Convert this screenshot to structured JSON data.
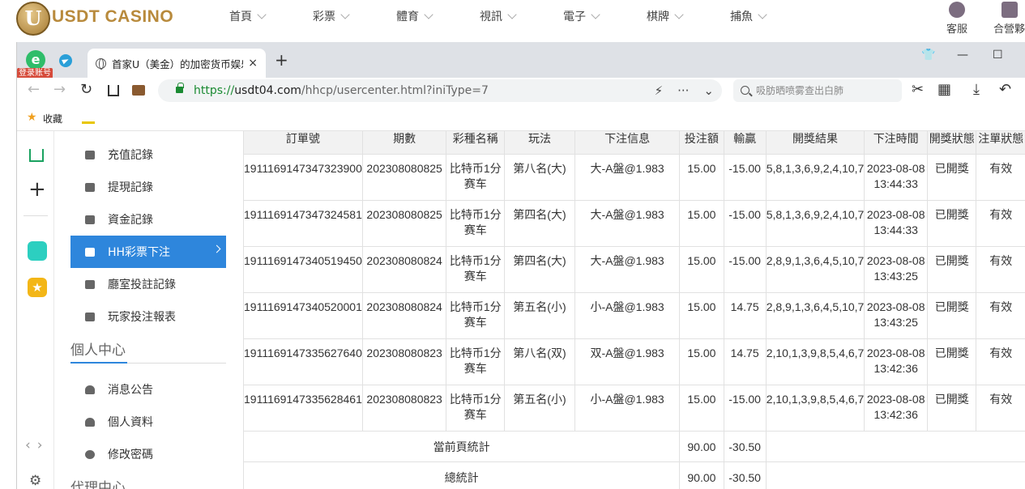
{
  "site": {
    "logo_letter": "U",
    "logo_text": "USDT CASINO",
    "nav": [
      "首頁",
      "彩票",
      "體育",
      "視訊",
      "電子",
      "棋牌",
      "捕魚"
    ],
    "right_items": [
      "客服",
      "合營夥"
    ]
  },
  "browser": {
    "login_badge": "登录账号",
    "ext_letter": "e",
    "tab_title": "首家U（美金）的加密货币娱乐",
    "tab_close": "×",
    "new_tab": "+",
    "url_proto": "https://",
    "url_host": "usdt04.com",
    "url_path": "/hhcp/usercenter.html?iniType=7",
    "search_placeholder": "吸肪晒喷雾查出白肺",
    "bookmark_label": "收藏"
  },
  "sidebar": {
    "items": [
      {
        "label": "充值記錄"
      },
      {
        "label": "提現記錄"
      },
      {
        "label": "資金記錄"
      },
      {
        "label": "HH彩票下注"
      },
      {
        "label": "廳室投註記錄"
      },
      {
        "label": "玩家投注報表"
      }
    ],
    "section_personal": "個人中心",
    "personal_items": [
      {
        "label": "消息公告"
      },
      {
        "label": "個人資料"
      },
      {
        "label": "修改密碼"
      }
    ],
    "section_agent": "代理中心"
  },
  "table": {
    "headers": [
      "訂單號",
      "期數",
      "彩種名稱",
      "玩法",
      "下注信息",
      "投注額",
      "輸贏",
      "開獎結果",
      "下注時間",
      "開獎狀態",
      "注單狀態"
    ],
    "rows": [
      [
        "1911169147347323900",
        "202308080825",
        "比特币1分赛车",
        "第八名(大)",
        "大-A盤@1.983",
        "15.00",
        "-15.00",
        "5,8,1,3,6,9,2,4,10,7",
        "2023-08-08 13:44:33",
        "已開獎",
        "有效"
      ],
      [
        "1911169147347324581",
        "202308080825",
        "比特币1分赛车",
        "第四名(大)",
        "大-A盤@1.983",
        "15.00",
        "-15.00",
        "5,8,1,3,6,9,2,4,10,7",
        "2023-08-08 13:44:33",
        "已開獎",
        "有效"
      ],
      [
        "1911169147340519450",
        "202308080824",
        "比特币1分赛车",
        "第四名(大)",
        "大-A盤@1.983",
        "15.00",
        "-15.00",
        "2,8,9,1,3,6,4,5,10,7",
        "2023-08-08 13:43:25",
        "已開獎",
        "有效"
      ],
      [
        "1911169147340520001",
        "202308080824",
        "比特币1分赛车",
        "第五名(小)",
        "小-A盤@1.983",
        "15.00",
        "14.75",
        "2,8,9,1,3,6,4,5,10,7",
        "2023-08-08 13:43:25",
        "已開獎",
        "有效"
      ],
      [
        "1911169147335627640",
        "202308080823",
        "比特币1分赛车",
        "第八名(双)",
        "双-A盤@1.983",
        "15.00",
        "14.75",
        "2,10,1,3,9,8,5,4,6,7",
        "2023-08-08 13:42:36",
        "已開獎",
        "有效"
      ],
      [
        "1911169147335628461",
        "202308080823",
        "比特币1分赛车",
        "第五名(小)",
        "小-A盤@1.983",
        "15.00",
        "-15.00",
        "2,10,1,3,9,8,5,4,6,7",
        "2023-08-08 13:42:36",
        "已開獎",
        "有效"
      ]
    ],
    "page_total": {
      "label": "當前頁統計",
      "bet": "90.00",
      "win": "-30.50"
    },
    "grand_total": {
      "label": "總統計",
      "bet": "90.00",
      "win": "-30.50"
    }
  }
}
